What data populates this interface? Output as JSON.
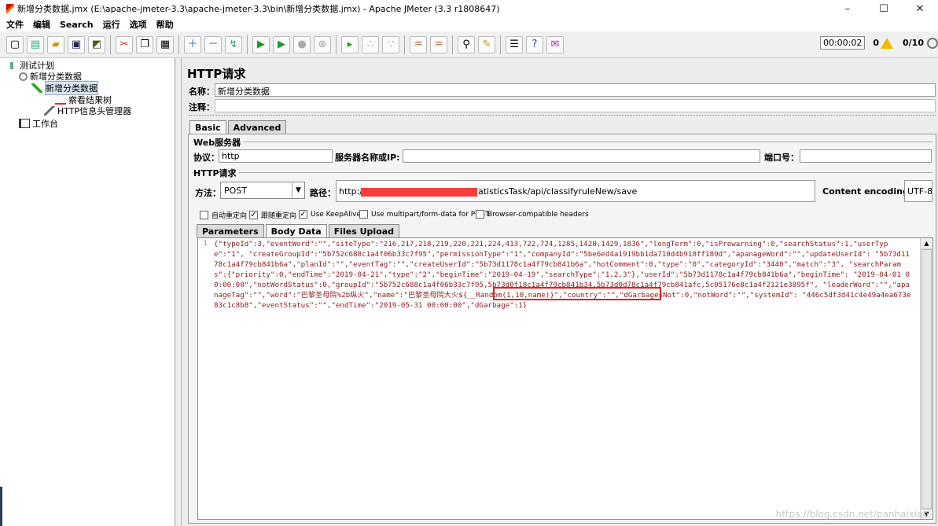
{
  "window": {
    "title": "新增分类数据.jmx (E:\\apache-jmeter-3.3\\apache-jmeter-3.3\\bin\\新增分类数据.jmx) - Apache JMeter (3.3 r1808647)",
    "minimize": "–",
    "maximize": "☐",
    "close": "✕"
  },
  "menu": [
    "文件",
    "编辑",
    "Search",
    "运行",
    "选项",
    "帮助"
  ],
  "toolbar": {
    "timer": "00:00:02",
    "warnings": "0",
    "threads": "0/10"
  },
  "tree": {
    "items": [
      {
        "label": "测试计划",
        "icon": "flask-icon"
      },
      {
        "label": "新增分类数据",
        "icon": "gear-icon"
      },
      {
        "label": "新增分类数据",
        "icon": "pencil-icon"
      },
      {
        "label": "察看结果树",
        "icon": "chart-icon"
      },
      {
        "label": "HTTP信息头管理器",
        "icon": "wrench-icon"
      },
      {
        "label": "工作台",
        "icon": "workbench-icon"
      }
    ]
  },
  "sampler": {
    "header": "HTTP请求",
    "name_label": "名称：",
    "name_value": "新增分类数据",
    "comment_label": "注释：",
    "tabs": [
      "Basic",
      "Advanced"
    ],
    "web_server_label": "Web服务器",
    "protocol_label": "协议：",
    "protocol_value": "http",
    "server_label": "服务器名称或IP:",
    "server_value": "",
    "port_label": "端口号：",
    "port_value": "",
    "http_request_label": "HTTP请求",
    "method_label": "方法：",
    "method_value": "POST",
    "path_label": "路径：",
    "path_prefix": "http://a",
    "path_suffix": "atisticsTask/api/classifyruleNew/save",
    "encoding_label": "Content encoding:",
    "encoding_value": "UTF-8",
    "checkboxes": [
      {
        "label": "自动重定向",
        "checked": false
      },
      {
        "label": "跟随重定向",
        "checked": true
      },
      {
        "label": "Use KeepAlive",
        "checked": true
      },
      {
        "label": "Use multipart/form-data for POST",
        "checked": false
      },
      {
        "label": "Browser-compatible headers",
        "checked": false
      }
    ],
    "body_tabs": [
      "Parameters",
      "Body Data",
      "Files Upload"
    ],
    "line_number": "1",
    "body_text": "{\"typeId\":3,\"eventWord\":\"\",\"siteType\":\"216,217,218,219,220,221,224,413,722,724,1285,1428,1429,1836\",\"longTerm\":0,\"isPrewarning\":0,\"searchStatus\":1,\"userType\":\"1\", \"createGroupId\":\"5b752c688c1a4f06b33c7f95\",\"permissionType\":\"1\",\"companyId\":\"5be6ed4a1919bb1da710d4b918ff189d\",\"apanageWord\":\"\",\"updateUserId\": \"5b73d1178c1a4f79cb841b6a\",\"planId\":\"\",\"eventTag\":\"\",\"createUserId\":\"5b73d1178c1a4f79cb841b6a\",\"hotComment\":0,\"type\":\"0\",\"categoryId\":\"3440\",\"match\":\"3\", \"searchParams\":{\"priority\":0,\"endTime\":\"2019-04-21\",\"type\":\"2\",\"beginTime\":\"2019-04-19\",\"searchType\":\"1,2,3\"},\"userId\":\"5b73d1178c1a4f79cb841b6a\",\"beginTime\": \"2019-04-01 00:00:00\",\"notWordStatus\":0,\"groupId\":\"5b752c688c1a4f06b33c7f95,5b73d0f18c1a4f79cb841b34,5b73d0d78c1a4f79cb841afc,5c05176e8c1a4f2121e3895f\", \"leaderWord\":\"\",\"apanageTag\":\"\",\"word\":\"巴黎圣母院%2b纵火\",\"name\":\"巴黎圣母院大火${__Random(1,10,name)}\",\"country\":\"\",\"dGarbagesNot\":0,\"notWord\":\"\",\"systemId\": \"446c5df3d41c4e49a4ea673e83c1c8b8\",\"eventStatus\":\"\",\"endTime\":\"2019-05-31 00:00:00\",\"dGarbage\":1}",
    "watermark": "https://blog.csdn.net/panhaixiao"
  },
  "colors": {
    "redaction": "#ff3b3b",
    "highlight_box": "#e02020",
    "code_text": "#8b1c1c",
    "current_line": "#fff9b0"
  }
}
